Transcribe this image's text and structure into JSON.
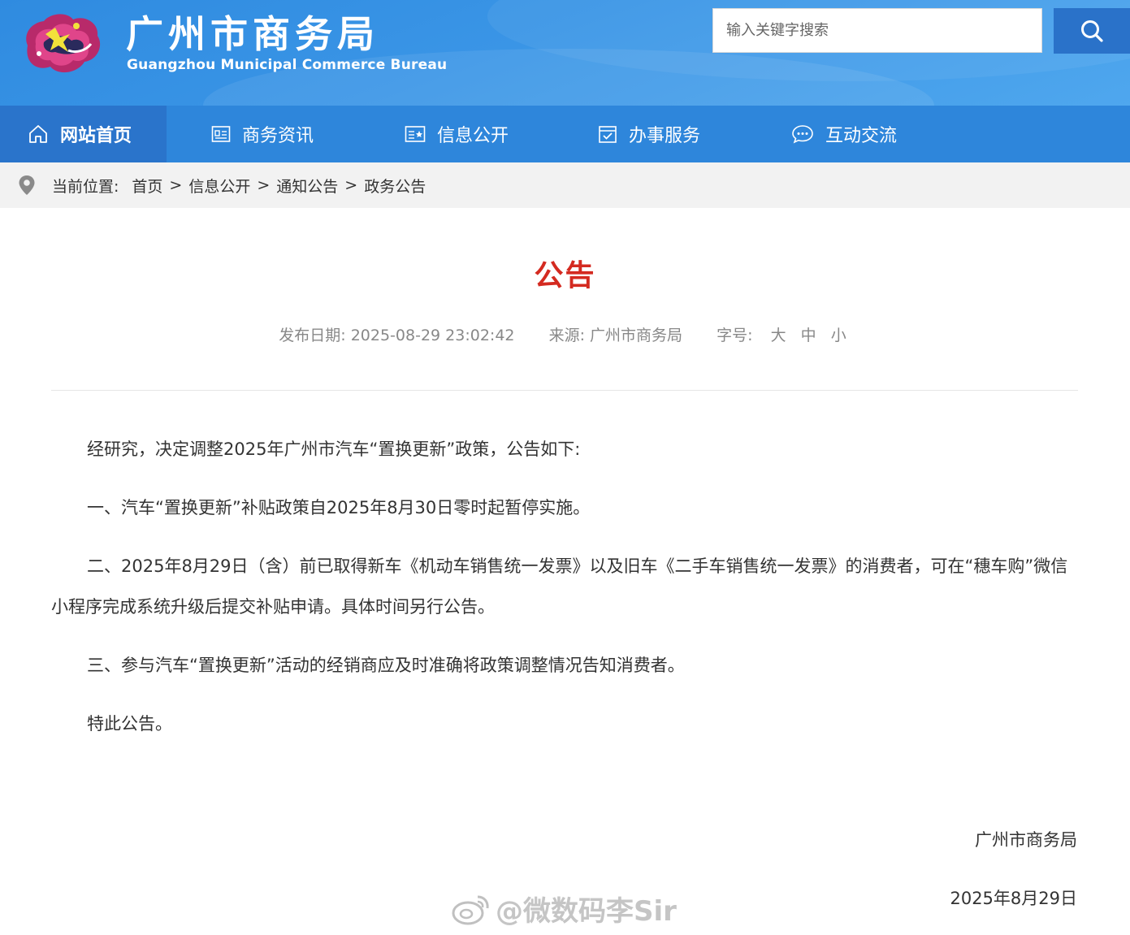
{
  "header": {
    "title": "广州市商务局",
    "subtitle": "Guangzhou Municipal Commerce Bureau",
    "search_placeholder": "输入关键字搜索",
    "search_icon": "search-icon"
  },
  "nav": {
    "items": [
      {
        "label": "网站首页",
        "icon": "home-icon",
        "active": true
      },
      {
        "label": "商务资讯",
        "icon": "news-icon"
      },
      {
        "label": "信息公开",
        "icon": "info-icon"
      },
      {
        "label": "办事服务",
        "icon": "checklist-icon"
      },
      {
        "label": "互动交流",
        "icon": "chat-icon"
      }
    ]
  },
  "breadcrumb": {
    "prefix": "当前位置:",
    "items": [
      "首页",
      "信息公开",
      "通知公告",
      "政务公告"
    ],
    "separator": ">"
  },
  "article": {
    "title": "公告",
    "date_label": "发布日期:",
    "date": "2025-08-29 23:02:42",
    "source_label": "来源:",
    "source": "广州市商务局",
    "font_label": "字号:",
    "font_sizes": [
      "大",
      "中",
      "小"
    ],
    "paragraphs": [
      "经研究，决定调整2025年广州市汽车“置换更新”政策，公告如下:",
      "一、汽车“置换更新”补贴政策自2025年8月30日零时起暂停实施。",
      "二、2025年8月29日（含）前已取得新车《机动车销售统一发票》以及旧车《二手车销售统一发票》的消费者，可在“穗车购”微信小程序完成系统升级后提交补贴申请。具体时间另行公告。",
      "三、参与汽车“置换更新”活动的经销商应及时准确将政策调整情况告知消费者。",
      "特此公告。"
    ],
    "signature": "广州市商务局",
    "sign_date": "2025年8月29日"
  },
  "watermark": "@微数码李Sir",
  "colors": {
    "header_blue": "#3a95e6",
    "nav_blue": "#2e86db",
    "nav_active": "#2a74cb",
    "title_red": "#d42a20"
  }
}
